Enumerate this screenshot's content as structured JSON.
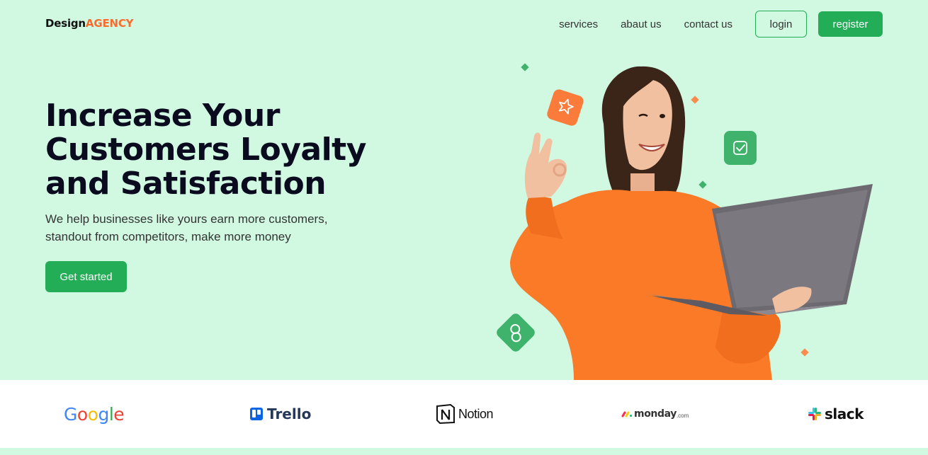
{
  "brand": {
    "name_part1": "Design",
    "name_part2": "AGENCY"
  },
  "nav": {
    "links": [
      "services",
      "abaut us",
      "contact us"
    ],
    "login_label": "login",
    "register_label": "register"
  },
  "hero": {
    "headline_lines": [
      "Increase Your",
      "Customers Loyalty",
      "and Satisfaction"
    ],
    "subtitle_lines": [
      "We help businesses like yours earn more customers,",
      "standout from competitors, make more money"
    ],
    "cta_label": "Get started"
  },
  "partners": {
    "google": "Google",
    "trello": "Trello",
    "notion": "Notion",
    "monday": "monday",
    "monday_suffix": ".com",
    "slack": "slack"
  },
  "colors": {
    "accent_green": "#22ad56",
    "brand_orange": "#fb6b2c",
    "hero_bg": "#d1f9e2"
  }
}
